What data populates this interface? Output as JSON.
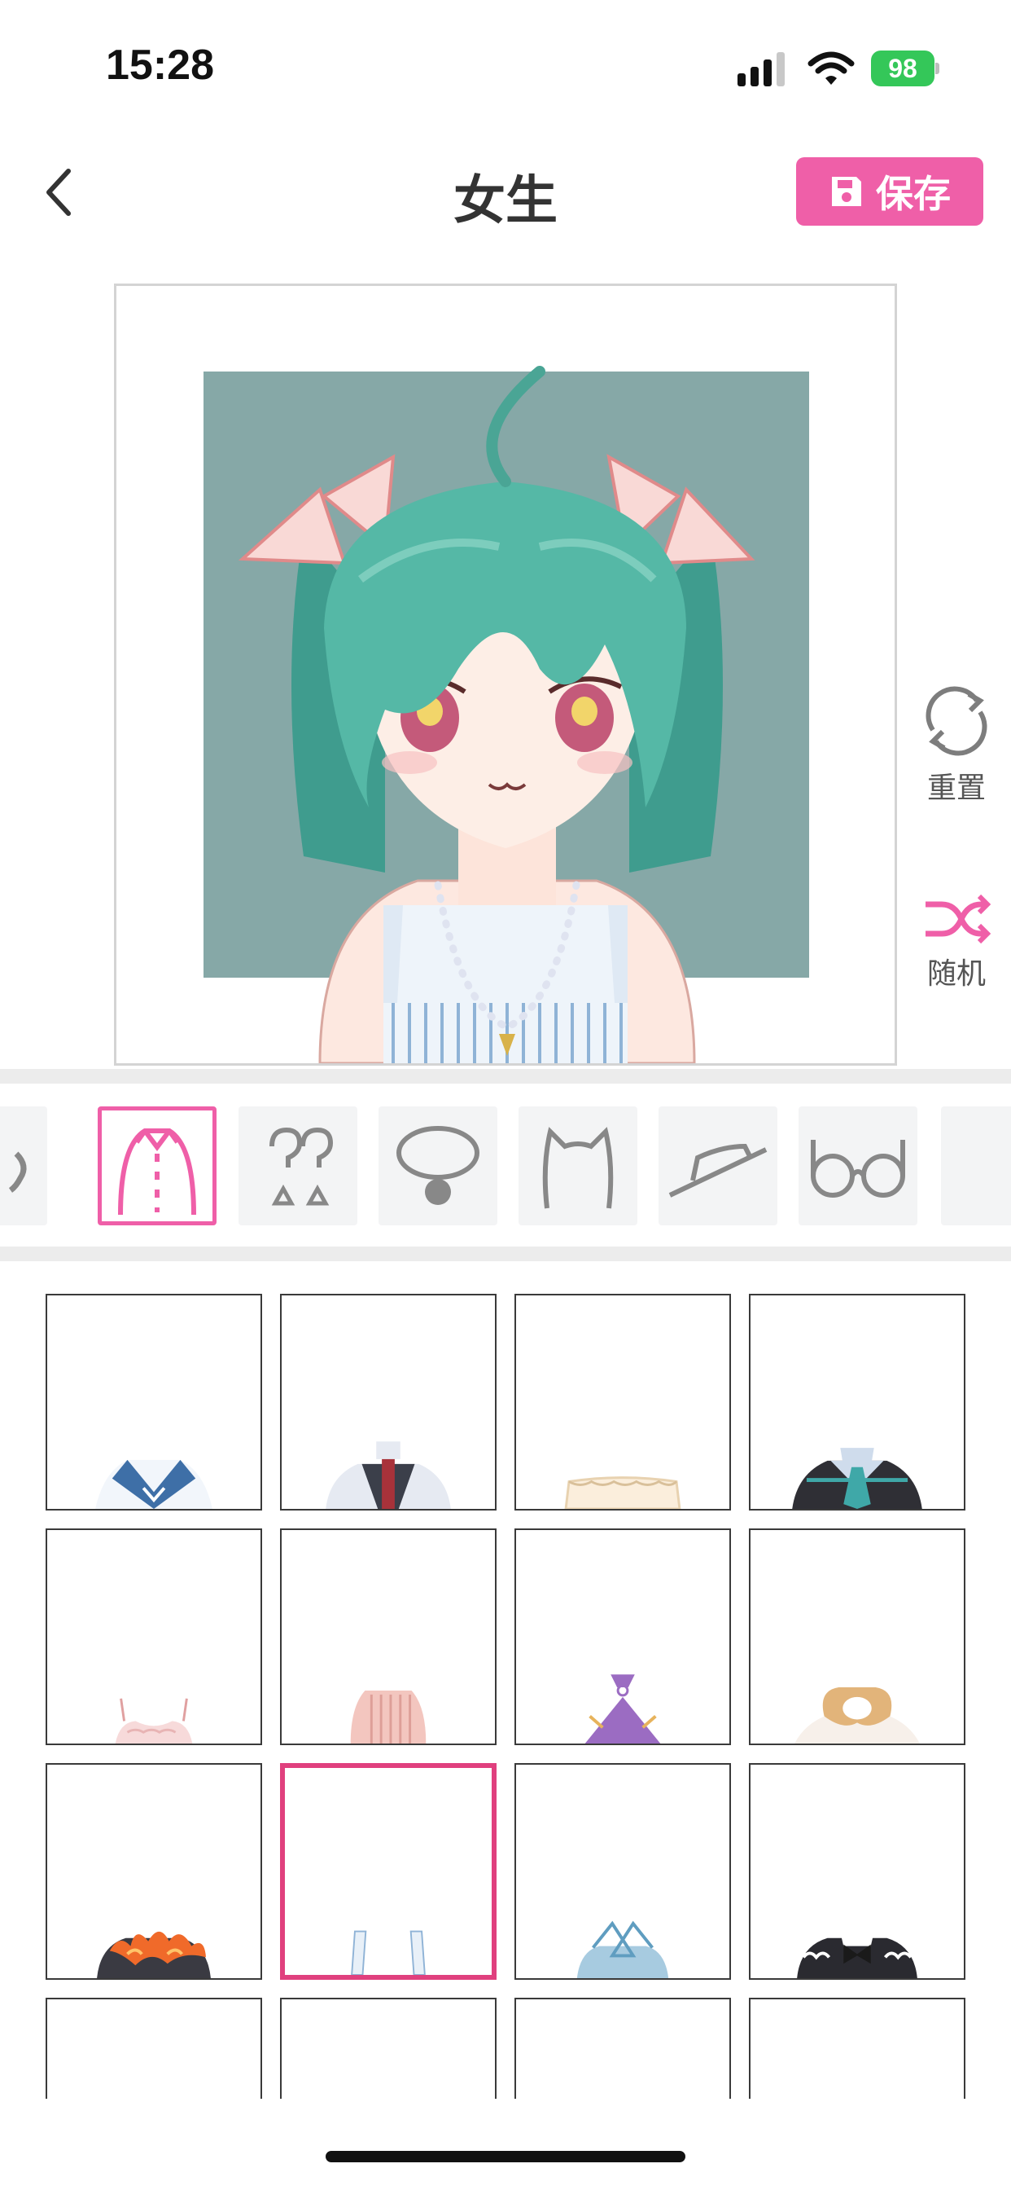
{
  "status_bar": {
    "time": "15:28",
    "battery": "98"
  },
  "nav": {
    "title": "女生",
    "save_label": "保存"
  },
  "side_actions": {
    "reset_label": "重置",
    "random_label": "随机"
  },
  "categories": [
    {
      "name": "partial-icon"
    },
    {
      "name": "top-clothes-icon",
      "selected": true
    },
    {
      "name": "random-question-icon"
    },
    {
      "name": "necklace-icon"
    },
    {
      "name": "cat-ears-icon"
    },
    {
      "name": "hat-icon"
    },
    {
      "name": "glasses-icon"
    }
  ],
  "outfit_grid": {
    "columns": 4,
    "items": [
      {
        "name": "sailor-collar"
      },
      {
        "name": "vest-with-tie"
      },
      {
        "name": "lace-collar"
      },
      {
        "name": "dark-coat-with-tie"
      },
      {
        "name": "pink-bra"
      },
      {
        "name": "pink-knit-sweater"
      },
      {
        "name": "purple-halter"
      },
      {
        "name": "beige-hood"
      },
      {
        "name": "flame-dress"
      },
      {
        "name": "striped-straps",
        "selected": true
      },
      {
        "name": "blue-crossed-top"
      },
      {
        "name": "maid-outfit"
      }
    ]
  },
  "colors": {
    "accent": "#ef5fa8",
    "selected_border": "#e0407e",
    "avatar_bg": "#86a8a7",
    "hair": "#55b8a6"
  }
}
